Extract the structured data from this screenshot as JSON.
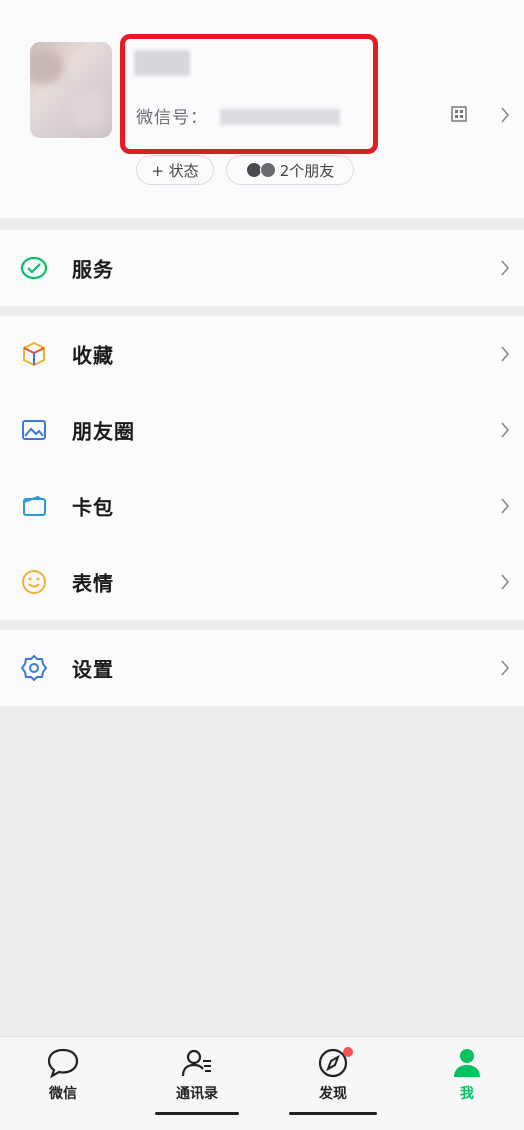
{
  "profile": {
    "wechat_id_label": "微信号：",
    "status_button": "+ 状态",
    "friends_label": "2个朋友"
  },
  "menu": {
    "services": "服务",
    "favorites": "收藏",
    "moments": "朋友圈",
    "cards": "卡包",
    "stickers": "表情",
    "settings": "设置"
  },
  "tabbar": {
    "chats": "微信",
    "contacts": "通讯录",
    "discover": "发现",
    "me": "我"
  },
  "colors": {
    "accent_green": "#07c160",
    "highlight_red": "#e31c23",
    "badge_red": "#fa5151"
  }
}
